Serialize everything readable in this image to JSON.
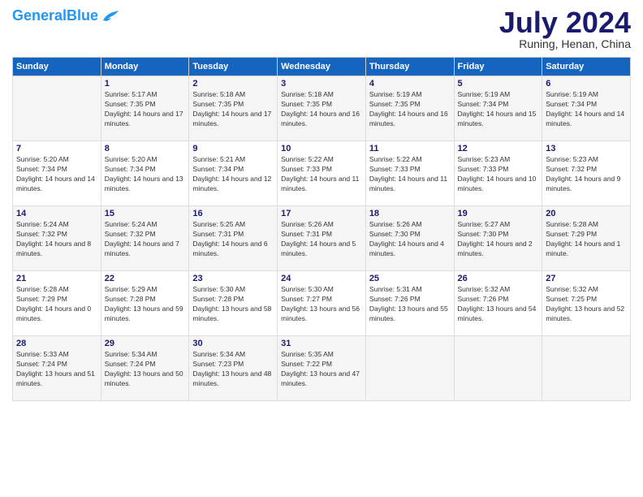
{
  "logo": {
    "line1": "General",
    "line2": "Blue"
  },
  "title": "July 2024",
  "location": "Runing, Henan, China",
  "weekdays": [
    "Sunday",
    "Monday",
    "Tuesday",
    "Wednesday",
    "Thursday",
    "Friday",
    "Saturday"
  ],
  "weeks": [
    [
      {
        "day": "",
        "sunrise": "",
        "sunset": "",
        "daylight": ""
      },
      {
        "day": "1",
        "sunrise": "Sunrise: 5:17 AM",
        "sunset": "Sunset: 7:35 PM",
        "daylight": "Daylight: 14 hours and 17 minutes."
      },
      {
        "day": "2",
        "sunrise": "Sunrise: 5:18 AM",
        "sunset": "Sunset: 7:35 PM",
        "daylight": "Daylight: 14 hours and 17 minutes."
      },
      {
        "day": "3",
        "sunrise": "Sunrise: 5:18 AM",
        "sunset": "Sunset: 7:35 PM",
        "daylight": "Daylight: 14 hours and 16 minutes."
      },
      {
        "day": "4",
        "sunrise": "Sunrise: 5:19 AM",
        "sunset": "Sunset: 7:35 PM",
        "daylight": "Daylight: 14 hours and 16 minutes."
      },
      {
        "day": "5",
        "sunrise": "Sunrise: 5:19 AM",
        "sunset": "Sunset: 7:34 PM",
        "daylight": "Daylight: 14 hours and 15 minutes."
      },
      {
        "day": "6",
        "sunrise": "Sunrise: 5:19 AM",
        "sunset": "Sunset: 7:34 PM",
        "daylight": "Daylight: 14 hours and 14 minutes."
      }
    ],
    [
      {
        "day": "7",
        "sunrise": "Sunrise: 5:20 AM",
        "sunset": "Sunset: 7:34 PM",
        "daylight": "Daylight: 14 hours and 14 minutes."
      },
      {
        "day": "8",
        "sunrise": "Sunrise: 5:20 AM",
        "sunset": "Sunset: 7:34 PM",
        "daylight": "Daylight: 14 hours and 13 minutes."
      },
      {
        "day": "9",
        "sunrise": "Sunrise: 5:21 AM",
        "sunset": "Sunset: 7:34 PM",
        "daylight": "Daylight: 14 hours and 12 minutes."
      },
      {
        "day": "10",
        "sunrise": "Sunrise: 5:22 AM",
        "sunset": "Sunset: 7:33 PM",
        "daylight": "Daylight: 14 hours and 11 minutes."
      },
      {
        "day": "11",
        "sunrise": "Sunrise: 5:22 AM",
        "sunset": "Sunset: 7:33 PM",
        "daylight": "Daylight: 14 hours and 11 minutes."
      },
      {
        "day": "12",
        "sunrise": "Sunrise: 5:23 AM",
        "sunset": "Sunset: 7:33 PM",
        "daylight": "Daylight: 14 hours and 10 minutes."
      },
      {
        "day": "13",
        "sunrise": "Sunrise: 5:23 AM",
        "sunset": "Sunset: 7:32 PM",
        "daylight": "Daylight: 14 hours and 9 minutes."
      }
    ],
    [
      {
        "day": "14",
        "sunrise": "Sunrise: 5:24 AM",
        "sunset": "Sunset: 7:32 PM",
        "daylight": "Daylight: 14 hours and 8 minutes."
      },
      {
        "day": "15",
        "sunrise": "Sunrise: 5:24 AM",
        "sunset": "Sunset: 7:32 PM",
        "daylight": "Daylight: 14 hours and 7 minutes."
      },
      {
        "day": "16",
        "sunrise": "Sunrise: 5:25 AM",
        "sunset": "Sunset: 7:31 PM",
        "daylight": "Daylight: 14 hours and 6 minutes."
      },
      {
        "day": "17",
        "sunrise": "Sunrise: 5:26 AM",
        "sunset": "Sunset: 7:31 PM",
        "daylight": "Daylight: 14 hours and 5 minutes."
      },
      {
        "day": "18",
        "sunrise": "Sunrise: 5:26 AM",
        "sunset": "Sunset: 7:30 PM",
        "daylight": "Daylight: 14 hours and 4 minutes."
      },
      {
        "day": "19",
        "sunrise": "Sunrise: 5:27 AM",
        "sunset": "Sunset: 7:30 PM",
        "daylight": "Daylight: 14 hours and 2 minutes."
      },
      {
        "day": "20",
        "sunrise": "Sunrise: 5:28 AM",
        "sunset": "Sunset: 7:29 PM",
        "daylight": "Daylight: 14 hours and 1 minute."
      }
    ],
    [
      {
        "day": "21",
        "sunrise": "Sunrise: 5:28 AM",
        "sunset": "Sunset: 7:29 PM",
        "daylight": "Daylight: 14 hours and 0 minutes."
      },
      {
        "day": "22",
        "sunrise": "Sunrise: 5:29 AM",
        "sunset": "Sunset: 7:28 PM",
        "daylight": "Daylight: 13 hours and 59 minutes."
      },
      {
        "day": "23",
        "sunrise": "Sunrise: 5:30 AM",
        "sunset": "Sunset: 7:28 PM",
        "daylight": "Daylight: 13 hours and 58 minutes."
      },
      {
        "day": "24",
        "sunrise": "Sunrise: 5:30 AM",
        "sunset": "Sunset: 7:27 PM",
        "daylight": "Daylight: 13 hours and 56 minutes."
      },
      {
        "day": "25",
        "sunrise": "Sunrise: 5:31 AM",
        "sunset": "Sunset: 7:26 PM",
        "daylight": "Daylight: 13 hours and 55 minutes."
      },
      {
        "day": "26",
        "sunrise": "Sunrise: 5:32 AM",
        "sunset": "Sunset: 7:26 PM",
        "daylight": "Daylight: 13 hours and 54 minutes."
      },
      {
        "day": "27",
        "sunrise": "Sunrise: 5:32 AM",
        "sunset": "Sunset: 7:25 PM",
        "daylight": "Daylight: 13 hours and 52 minutes."
      }
    ],
    [
      {
        "day": "28",
        "sunrise": "Sunrise: 5:33 AM",
        "sunset": "Sunset: 7:24 PM",
        "daylight": "Daylight: 13 hours and 51 minutes."
      },
      {
        "day": "29",
        "sunrise": "Sunrise: 5:34 AM",
        "sunset": "Sunset: 7:24 PM",
        "daylight": "Daylight: 13 hours and 50 minutes."
      },
      {
        "day": "30",
        "sunrise": "Sunrise: 5:34 AM",
        "sunset": "Sunset: 7:23 PM",
        "daylight": "Daylight: 13 hours and 48 minutes."
      },
      {
        "day": "31",
        "sunrise": "Sunrise: 5:35 AM",
        "sunset": "Sunset: 7:22 PM",
        "daylight": "Daylight: 13 hours and 47 minutes."
      },
      {
        "day": "",
        "sunrise": "",
        "sunset": "",
        "daylight": ""
      },
      {
        "day": "",
        "sunrise": "",
        "sunset": "",
        "daylight": ""
      },
      {
        "day": "",
        "sunrise": "",
        "sunset": "",
        "daylight": ""
      }
    ]
  ]
}
